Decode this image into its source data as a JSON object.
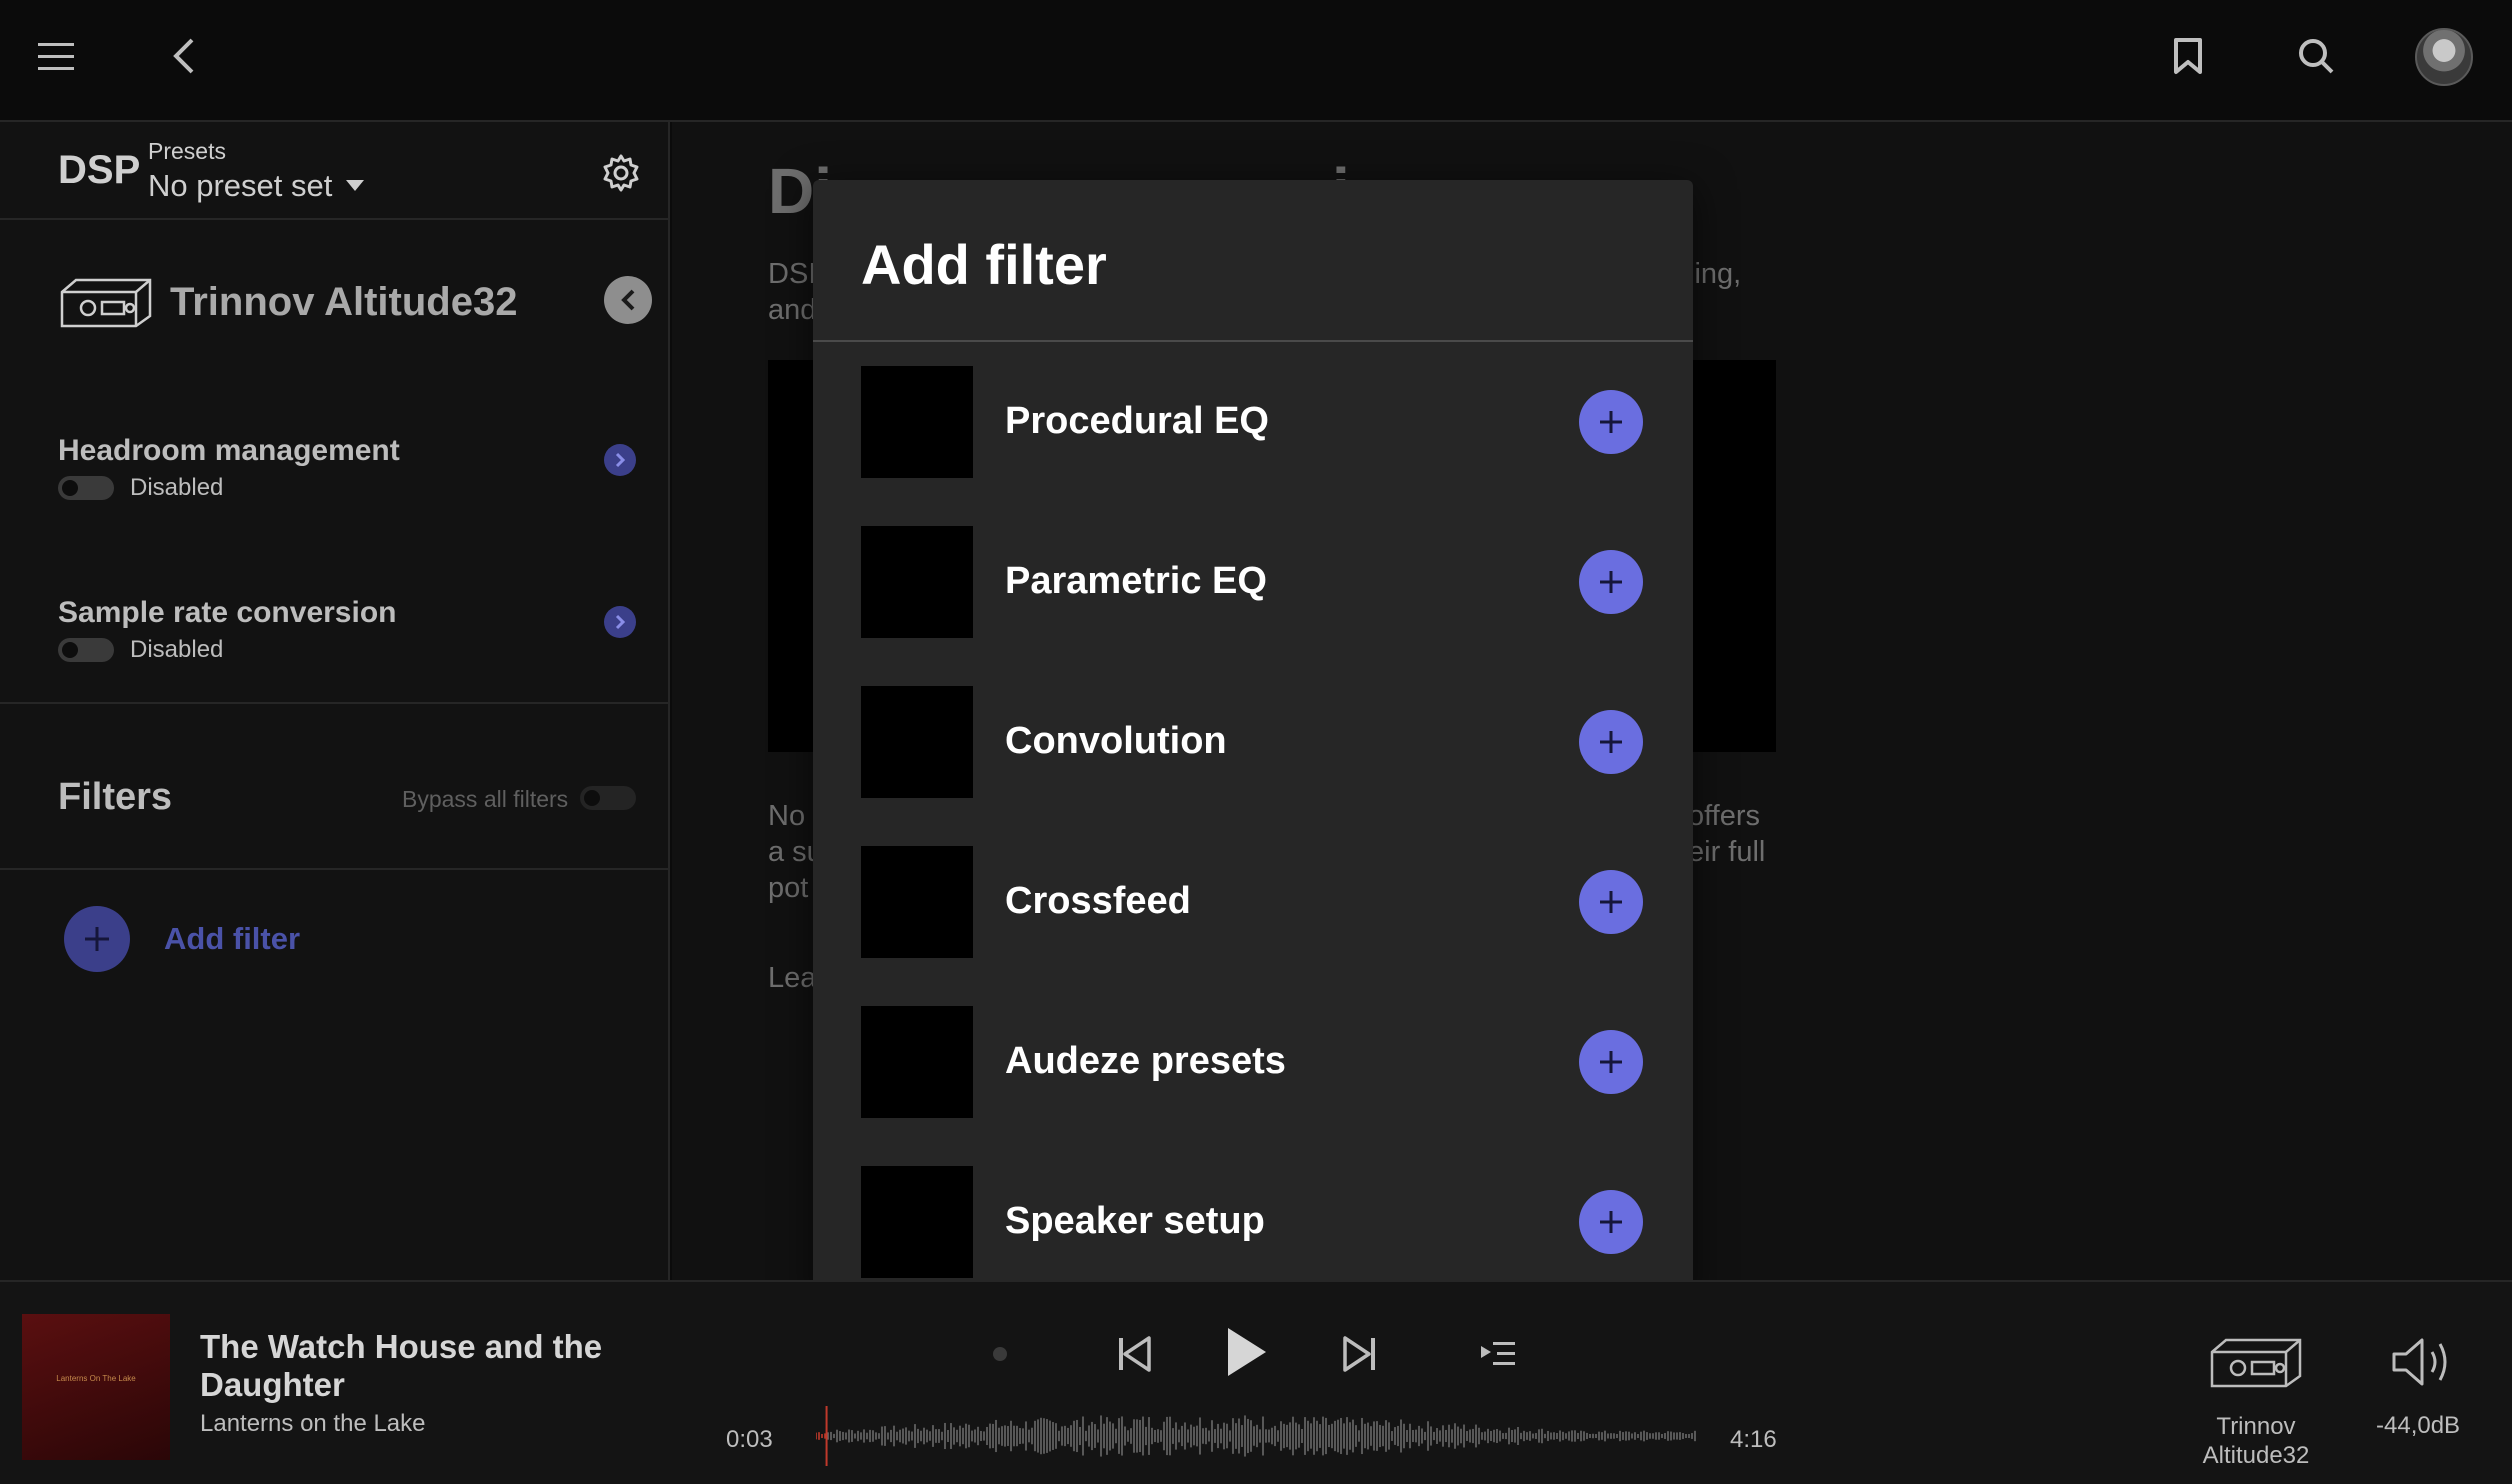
{
  "header": {
    "menu_icon": "hamburger-menu-icon",
    "back_icon": "chevron-left-icon",
    "bookmark_icon": "bookmark-icon",
    "search_icon": "search-icon",
    "avatar": "user-avatar"
  },
  "sidebar": {
    "dsp_title": "DSP",
    "presets_label": "Presets",
    "preset_value": "No preset set",
    "settings_icon": "gear-icon",
    "device_name": "Trinnov Altitude32",
    "settings": [
      {
        "title": "Headroom management",
        "state": "Disabled"
      },
      {
        "title": "Sample rate conversion",
        "state": "Disabled"
      }
    ],
    "filters_title": "Filters",
    "bypass_label": "Bypass all filters",
    "add_filter_label": "Add filter"
  },
  "main": {
    "title_fragment": "Di",
    "title_fragment_right": "i",
    "line1_left": "DSI",
    "line1_right": "ling,",
    "line2_left": "and",
    "para2_line1_left": "No",
    "para2_line1_right": "offers",
    "para2_line2_left": "a su",
    "para2_line2_right": "eir full",
    "para2_line3_left": "pot",
    "learn_fragment": "Lea"
  },
  "modal": {
    "title": "Add filter",
    "filters": [
      {
        "label": "Procedural EQ"
      },
      {
        "label": "Parametric EQ"
      },
      {
        "label": "Convolution"
      },
      {
        "label": "Crossfeed"
      },
      {
        "label": "Audeze presets"
      },
      {
        "label": "Speaker setup"
      }
    ],
    "accent_color": "#6a6ee0"
  },
  "player": {
    "album_art_text": "Lanterns On The Lake",
    "track_title": "The Watch House and the Daughter",
    "artist": "Lanterns on the Lake",
    "elapsed": "0:03",
    "duration": "4:16",
    "progress_fraction": 0.012,
    "output_device": "Trinnov Altitude32",
    "volume": "-44,0dB",
    "icons": {
      "radio": "radio-dot-icon",
      "previous": "skip-previous-icon",
      "play": "play-icon",
      "next": "skip-next-icon",
      "queue": "queue-icon",
      "volume": "speaker-volume-icon"
    }
  }
}
